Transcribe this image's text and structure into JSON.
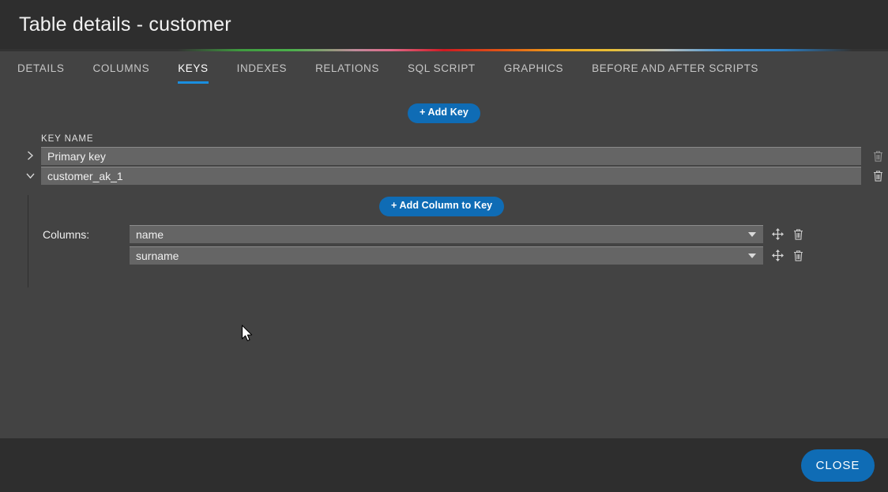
{
  "window": {
    "title": "Table details - customer"
  },
  "tabs": [
    {
      "label": "DETAILS",
      "active": false
    },
    {
      "label": "COLUMNS",
      "active": false
    },
    {
      "label": "KEYS",
      "active": true
    },
    {
      "label": "INDEXES",
      "active": false
    },
    {
      "label": "RELATIONS",
      "active": false
    },
    {
      "label": "SQL SCRIPT",
      "active": false
    },
    {
      "label": "GRAPHICS",
      "active": false
    },
    {
      "label": "BEFORE AND AFTER SCRIPTS",
      "active": false
    }
  ],
  "keys_panel": {
    "add_key_label": "+ Add Key",
    "column_header": "KEY NAME",
    "rows": [
      {
        "name": "Primary key",
        "expanded": false,
        "chevron": "chevron-right-icon"
      },
      {
        "name": "customer_ak_1",
        "expanded": true,
        "chevron": "chevron-down-icon"
      }
    ],
    "delete_icon": "trash-icon"
  },
  "expanded_key": {
    "add_column_label": "+ Add Column to Key",
    "columns_label": "Columns:",
    "columns": [
      {
        "value": "name"
      },
      {
        "value": "surname"
      }
    ],
    "move_icon": "move-arrows-icon",
    "delete_icon": "trash-icon",
    "dropdown_icon": "caret-down-icon"
  },
  "footer": {
    "close_label": "CLOSE"
  },
  "colors": {
    "accent_blue": "#0f6cb5",
    "tab_underline": "#1a8fe0",
    "titlebar_bg": "#2e2e2e",
    "body_bg": "#434343",
    "field_bg": "#656565"
  }
}
